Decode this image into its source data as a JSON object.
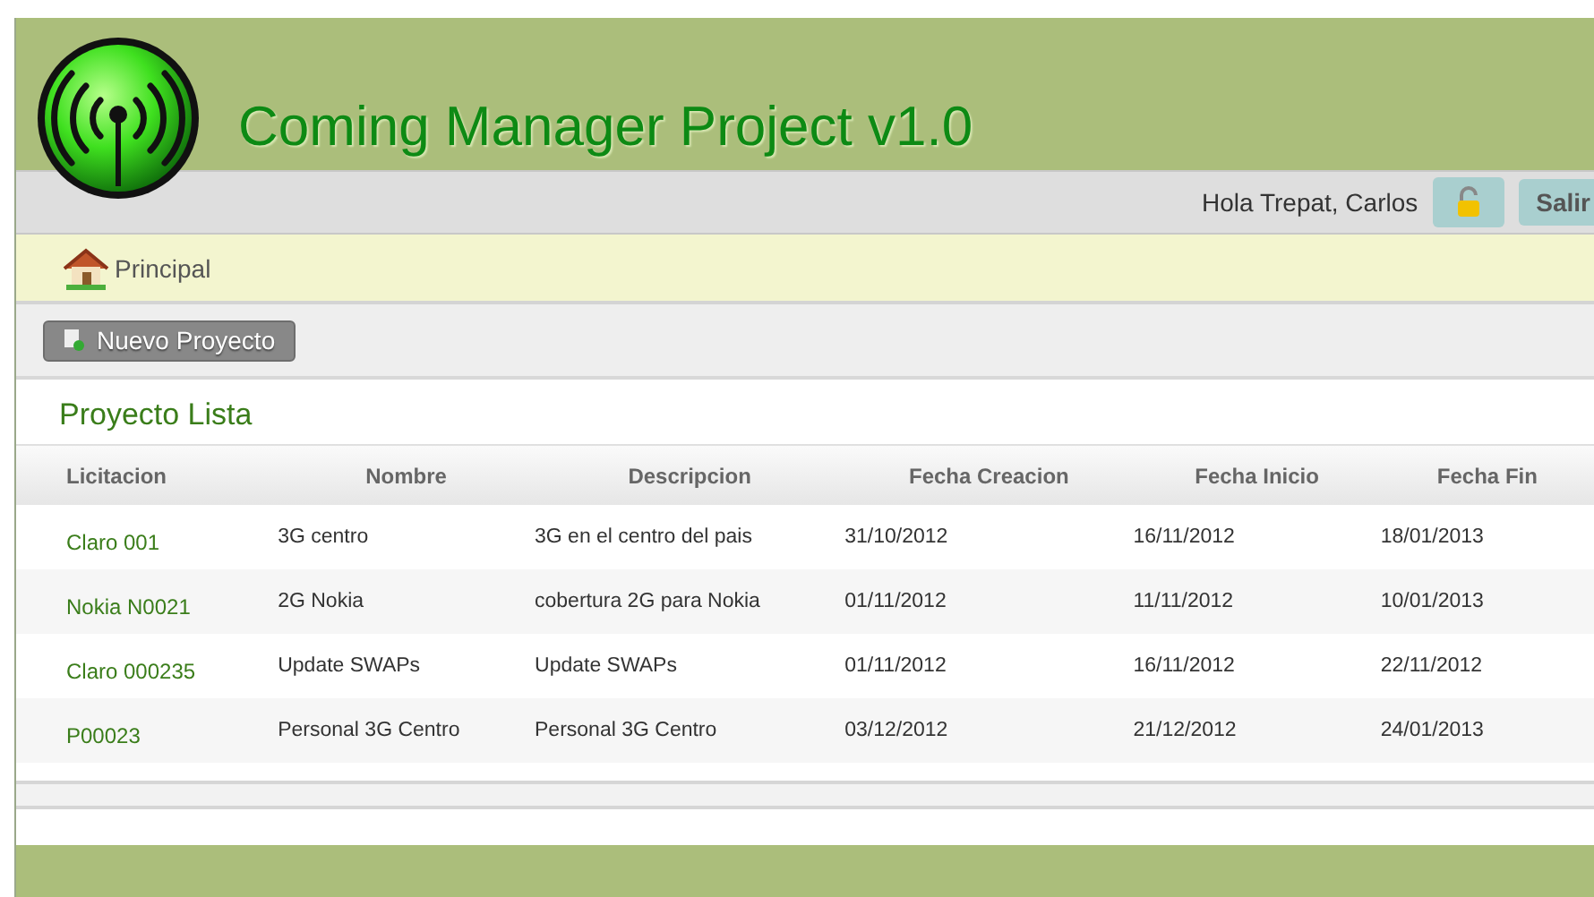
{
  "header": {
    "title": "Coming Manager Project v1.0"
  },
  "user_bar": {
    "greeting": "Hola Trepat, Carlos",
    "logout": "Salir"
  },
  "breadcrumb": {
    "label": "Principal"
  },
  "toolbar": {
    "new_button": "Nuevo Proyecto"
  },
  "list": {
    "title": "Proyecto Lista",
    "columns": [
      "Licitacion",
      "Nombre",
      "Descripcion",
      "Fecha Creacion",
      "Fecha Inicio",
      "Fecha Fin"
    ],
    "rows": [
      {
        "cells": [
          "Claro 001",
          "3G centro",
          "3G en el centro del pais",
          "31/10/2012",
          "16/11/2012",
          "18/01/2013"
        ]
      },
      {
        "cells": [
          "Nokia N0021",
          "2G Nokia",
          "cobertura 2G para Nokia",
          "01/11/2012",
          "11/11/2012",
          "10/01/2013"
        ]
      },
      {
        "cells": [
          "Claro 000235",
          "Update SWAPs",
          "Update SWAPs",
          "01/11/2012",
          "16/11/2012",
          "22/11/2012"
        ]
      },
      {
        "cells": [
          "P00023",
          "Personal 3G Centro",
          "Personal 3G Centro",
          "03/12/2012",
          "21/12/2012",
          "24/01/2013"
        ]
      }
    ]
  }
}
